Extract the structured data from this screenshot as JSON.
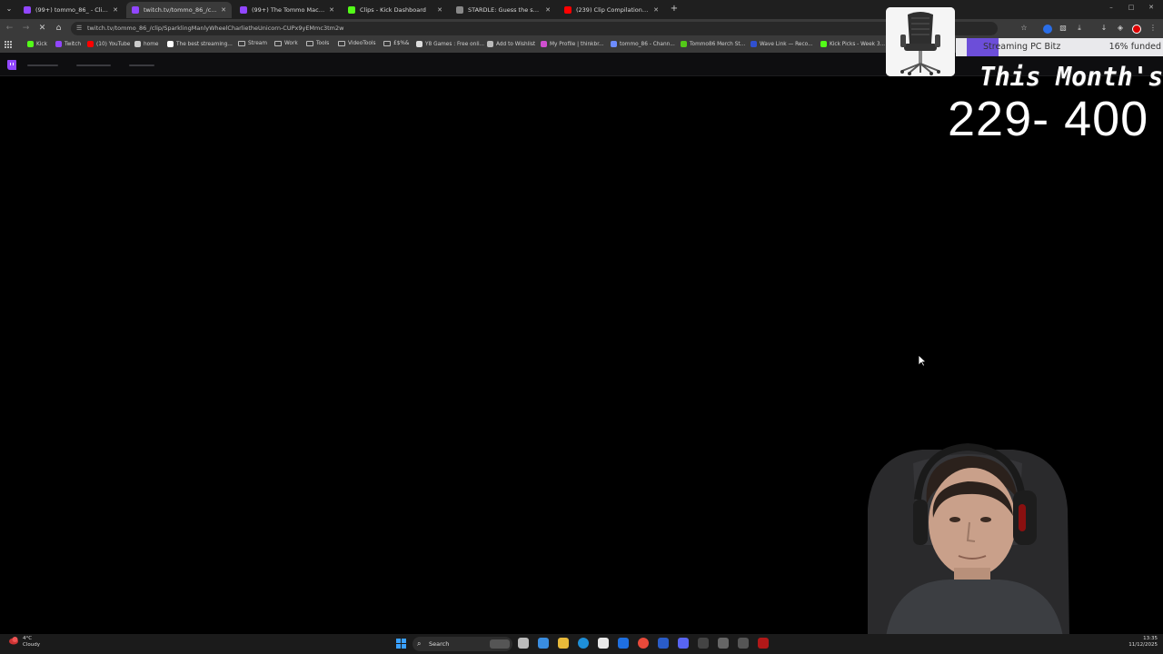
{
  "browser": {
    "tabs": [
      {
        "title": "(99+) tommo_86_ - Clips Mana",
        "favicon_color": "#9146ff",
        "active": false
      },
      {
        "title": "twitch.tv/tommo_86_/clip/Spar",
        "favicon_color": "#9146ff",
        "active": true
      },
      {
        "title": "(99+) The Tommo Macarena - T",
        "favicon_color": "#9146ff",
        "active": false
      },
      {
        "title": "Clips - Kick Dashboard",
        "favicon_color": "#53fc18",
        "active": false
      },
      {
        "title": "STARDLE: Guess the ship!",
        "favicon_color": "#888888",
        "active": false
      },
      {
        "title": "(239) Clip Compilation: Episod",
        "favicon_color": "#ff0000",
        "active": false
      }
    ],
    "url": "twitch.tv/tommo_86_/clip/SparklingManlyWheelCharlietheUnicorn-CUPx9yEMmc3tm2w",
    "bookmarks": [
      {
        "label": "Kick",
        "color": "#53fc18",
        "type": "site"
      },
      {
        "label": "Twitch",
        "color": "#9146ff",
        "type": "site"
      },
      {
        "label": "(10) YouTube",
        "color": "#ff0000",
        "type": "site"
      },
      {
        "label": "home",
        "color": "#cccccc",
        "type": "site"
      },
      {
        "label": "The best streaming...",
        "color": "#ffffff",
        "type": "site"
      },
      {
        "label": "Stream",
        "color": "",
        "type": "folder"
      },
      {
        "label": "Work",
        "color": "",
        "type": "folder"
      },
      {
        "label": "Tools",
        "color": "",
        "type": "folder"
      },
      {
        "label": "VideoTools",
        "color": "",
        "type": "folder"
      },
      {
        "label": "£$%&",
        "color": "",
        "type": "folder"
      },
      {
        "label": "Y8 Games : Free onli...",
        "color": "#dddddd",
        "type": "site"
      },
      {
        "label": "Add to Wishlist",
        "color": "#bbbbbb",
        "type": "site"
      },
      {
        "label": "My Profile | thinkbr...",
        "color": "#d04fd0",
        "type": "site"
      },
      {
        "label": "tommo_86 - Chann...",
        "color": "#6d8cff",
        "type": "site"
      },
      {
        "label": "Tommo86 Merch St...",
        "color": "#53c818",
        "type": "site"
      },
      {
        "label": "Wave Link — Reco...",
        "color": "#3050d0",
        "type": "site"
      },
      {
        "label": "Kick Picks - Week 3...",
        "color": "#53fc18",
        "type": "site"
      }
    ]
  },
  "overlay": {
    "funding_title": "Streaming PC Bitz",
    "funding_percent_label": "16% funded",
    "funding_fraction": 0.16,
    "month_label": "This Month's",
    "month_count": "229- 400"
  },
  "taskbar": {
    "weather_temp": "4°C",
    "weather_desc": "Cloudy",
    "search_label": "Search",
    "time": "13:35",
    "date": "11/12/2025"
  },
  "colors": {
    "twitch": "#9146ff",
    "kick": "#53fc18",
    "funding_fill": "#6c4ed9"
  }
}
